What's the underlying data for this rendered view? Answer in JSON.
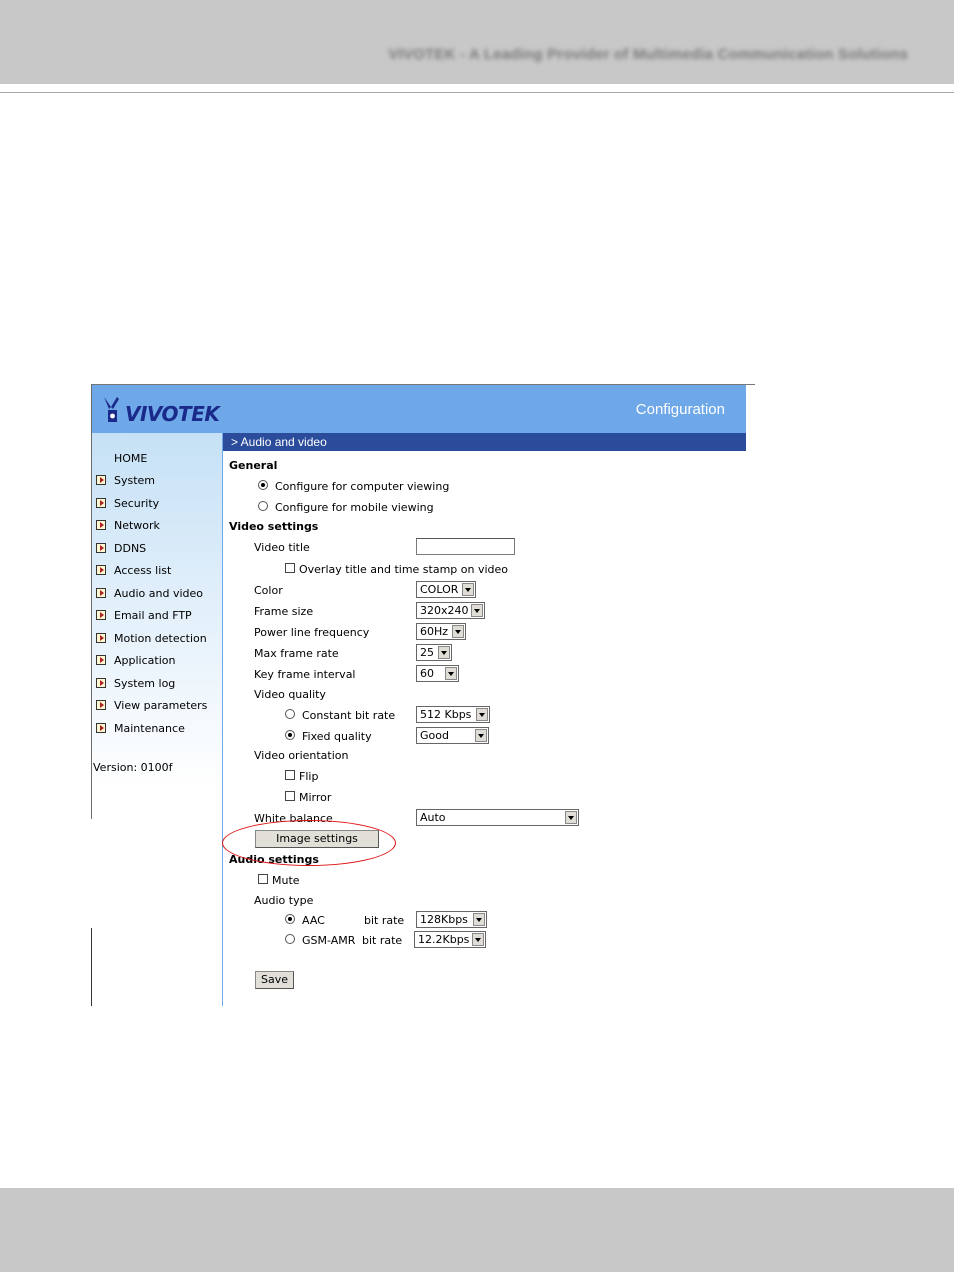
{
  "page": {
    "header_text": "VIVOTEK - A Leading Provider of Multimedia Communication Solutions"
  },
  "app": {
    "logo_text": "VIVOTEK",
    "title": "Configuration",
    "section_title": "> Audio and video",
    "version": "Version: 0100f"
  },
  "sidebar": {
    "home": "HOME",
    "items": [
      {
        "label": "System"
      },
      {
        "label": "Security"
      },
      {
        "label": "Network"
      },
      {
        "label": "DDNS"
      },
      {
        "label": "Access list"
      },
      {
        "label": "Audio and video"
      },
      {
        "label": "Email and FTP"
      },
      {
        "label": "Motion detection"
      },
      {
        "label": "Application"
      },
      {
        "label": "System log"
      },
      {
        "label": "View parameters"
      },
      {
        "label": "Maintenance"
      }
    ]
  },
  "general": {
    "heading": "General",
    "option_computer": "Configure for computer viewing",
    "option_mobile": "Configure for mobile viewing",
    "selected": "computer"
  },
  "video": {
    "heading": "Video settings",
    "title_label": "Video title",
    "title_value": "",
    "overlay_label": "Overlay title and time stamp on video",
    "overlay_checked": false,
    "color_label": "Color",
    "color_value": "COLOR",
    "frame_size_label": "Frame size",
    "frame_size_value": "320x240",
    "power_label": "Power line frequency",
    "power_value": "60Hz",
    "max_rate_label": "Max frame rate",
    "max_rate_value": "25",
    "key_interval_label": "Key frame interval",
    "key_interval_value": "60",
    "quality_label": "Video quality",
    "cbr_label": "Constant bit rate",
    "cbr_value": "512 Kbps",
    "fixed_label": "Fixed quality",
    "fixed_value": "Good",
    "quality_selected": "fixed",
    "orientation_label": "Video orientation",
    "flip_label": "Flip",
    "mirror_label": "Mirror",
    "flip_checked": false,
    "mirror_checked": false,
    "wb_label": "White balance",
    "wb_value": "Auto",
    "image_settings_label": "Image settings"
  },
  "audio": {
    "heading": "Audio settings",
    "mute_label": "Mute",
    "mute_checked": false,
    "type_label": "Audio type",
    "aac_label": "AAC",
    "gsm_label": "GSM-AMR",
    "bitrate_label": "bit rate",
    "aac_bitrate": "128Kbps",
    "gsm_bitrate": "12.2Kbps",
    "selected": "aac"
  },
  "actions": {
    "save_label": "Save"
  },
  "colors": {
    "banner": "#6fa8e8",
    "section_bar": "#2a4c9a",
    "annotation": "#e01010",
    "page_chrome": "#c8c8c8"
  }
}
